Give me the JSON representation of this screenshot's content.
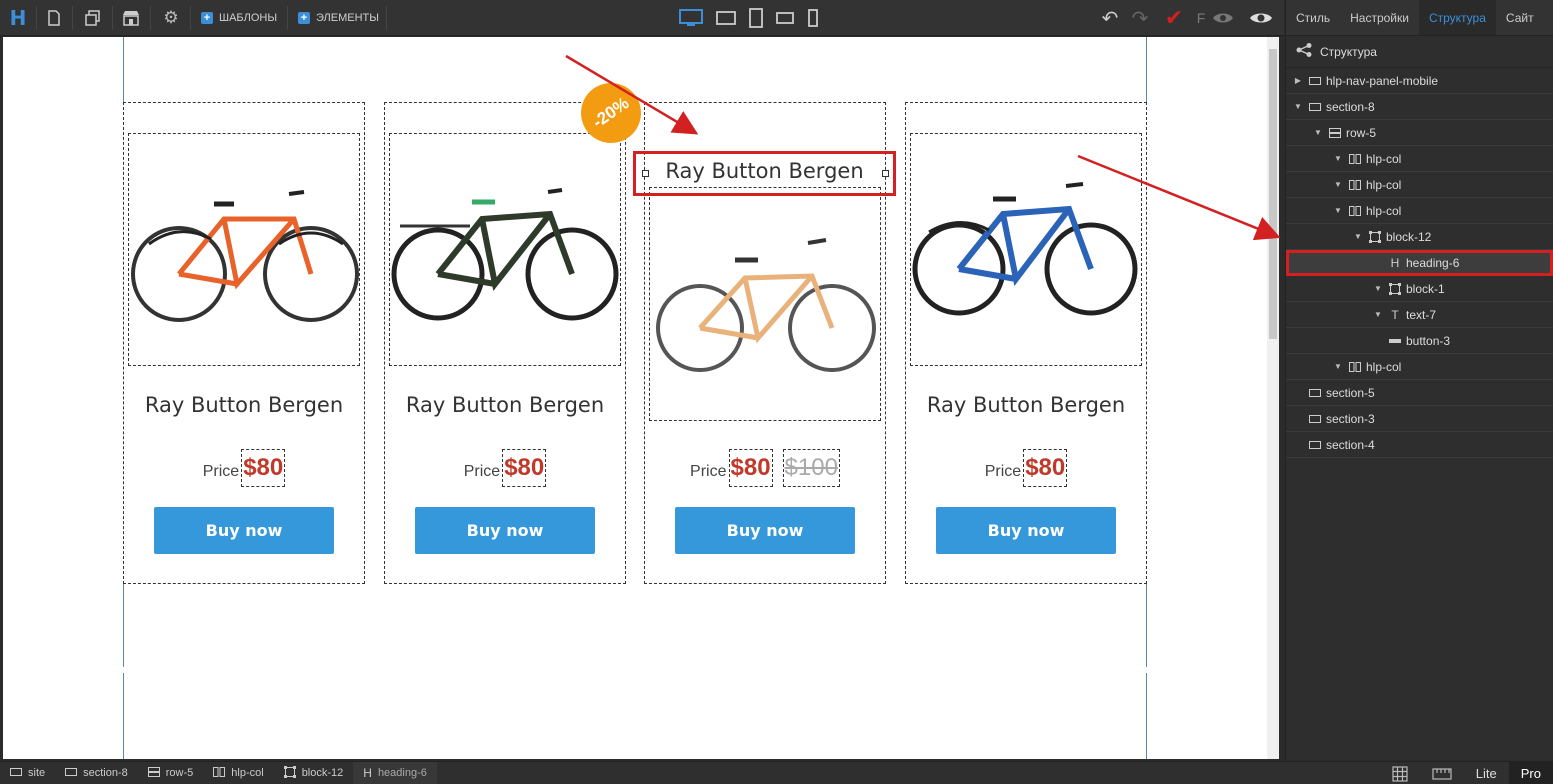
{
  "toolbar": {
    "logo": "H",
    "templates_label": "ШАБЛОНЫ",
    "elements_label": "ЭЛЕМЕНТЫ",
    "font_letter": "F"
  },
  "cards": [
    {
      "title": "Ray Button Bergen",
      "price_label": "Price",
      "price": "$80",
      "button": "Buy now",
      "bike_color": "#e8622a"
    },
    {
      "title": "Ray Button Bergen",
      "price_label": "Price",
      "price": "$80",
      "button": "Buy now",
      "bike_color": "#2f3b2a"
    },
    {
      "title": "Ray Button Bergen",
      "price_label": "Price",
      "price": "$80",
      "old_price": "$100",
      "button": "Buy now",
      "badge": "-20%",
      "bike_color": "#e8b27a"
    },
    {
      "title": "Ray Button Bergen",
      "price_label": "Price",
      "price": "$80",
      "button": "Buy now",
      "bike_color": "#2b63b8"
    }
  ],
  "panel": {
    "tabs": [
      "Стиль",
      "Настройки",
      "Структура",
      "Сайт"
    ],
    "active_tab": "Структура",
    "header": "Структура",
    "tree": [
      {
        "label": "hlp-nav-panel-mobile",
        "icon": "section-icon",
        "arrow": "right"
      },
      {
        "label": "section-8",
        "icon": "section-icon",
        "arrow": "down"
      },
      {
        "label": "row-5",
        "icon": "row-icon",
        "arrow": "down"
      },
      {
        "label": "hlp-col",
        "icon": "col-icon",
        "arrow": "down"
      },
      {
        "label": "hlp-col",
        "icon": "col-icon",
        "arrow": "down"
      },
      {
        "label": "hlp-col",
        "icon": "col-icon",
        "arrow": "down"
      },
      {
        "label": "block-12",
        "icon": "block-icon",
        "arrow": "down"
      },
      {
        "label": "heading-6",
        "icon": "heading-icon",
        "arrow": "",
        "selected": true
      },
      {
        "label": "block-1",
        "icon": "block-icon",
        "arrow": "down"
      },
      {
        "label": "text-7",
        "icon": "text-icon",
        "arrow": "down"
      },
      {
        "label": "button-3",
        "icon": "button-icon",
        "arrow": ""
      },
      {
        "label": "hlp-col",
        "icon": "col-icon",
        "arrow": "down"
      },
      {
        "label": "section-5",
        "icon": "section-icon",
        "arrow": ""
      },
      {
        "label": "section-3",
        "icon": "section-icon",
        "arrow": ""
      },
      {
        "label": "section-4",
        "icon": "section-icon",
        "arrow": ""
      }
    ]
  },
  "breadcrumb": [
    {
      "label": "site",
      "icon": "section-icon"
    },
    {
      "label": "section-8",
      "icon": "section-icon"
    },
    {
      "label": "row-5",
      "icon": "row-icon"
    },
    {
      "label": "hlp-col",
      "icon": "col-icon"
    },
    {
      "label": "block-12",
      "icon": "block-icon"
    },
    {
      "label": "heading-6",
      "icon": "heading-icon",
      "current": true
    }
  ],
  "modes": {
    "lite": "Lite",
    "pro": "Pro",
    "active": "Pro"
  },
  "colors": {
    "accent": "#3b8fd9",
    "buy": "#3498db",
    "price": "#c0392b",
    "badge": "#f39c12",
    "highlight": "#d32020"
  }
}
